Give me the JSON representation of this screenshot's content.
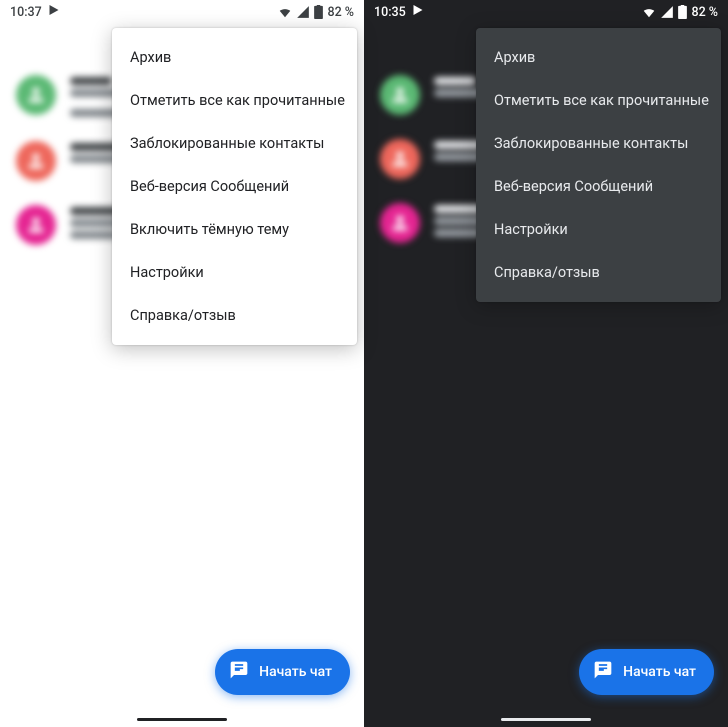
{
  "light": {
    "status": {
      "time": "10:37",
      "battery": "82 %"
    },
    "menu": {
      "items": [
        "Архив",
        "Отметить все как прочитанные",
        "Заблокированные контакты",
        "Веб-версия Сообщений",
        "Включить тёмную тему",
        "Настройки",
        "Справка/отзыв"
      ]
    },
    "fab": {
      "label": "Начать чат"
    }
  },
  "dark": {
    "status": {
      "time": "10:35",
      "battery": "82 %"
    },
    "menu": {
      "items": [
        "Архив",
        "Отметить все как прочитанные",
        "Заблокированные контакты",
        "Веб-версия Сообщений",
        "Настройки",
        "Справка/отзыв"
      ]
    },
    "fab": {
      "label": "Начать чат"
    }
  },
  "colors": {
    "accent": "#1a73e8",
    "light_bg": "#ffffff",
    "dark_bg": "#202124",
    "dark_menu_bg": "#3c4043"
  }
}
